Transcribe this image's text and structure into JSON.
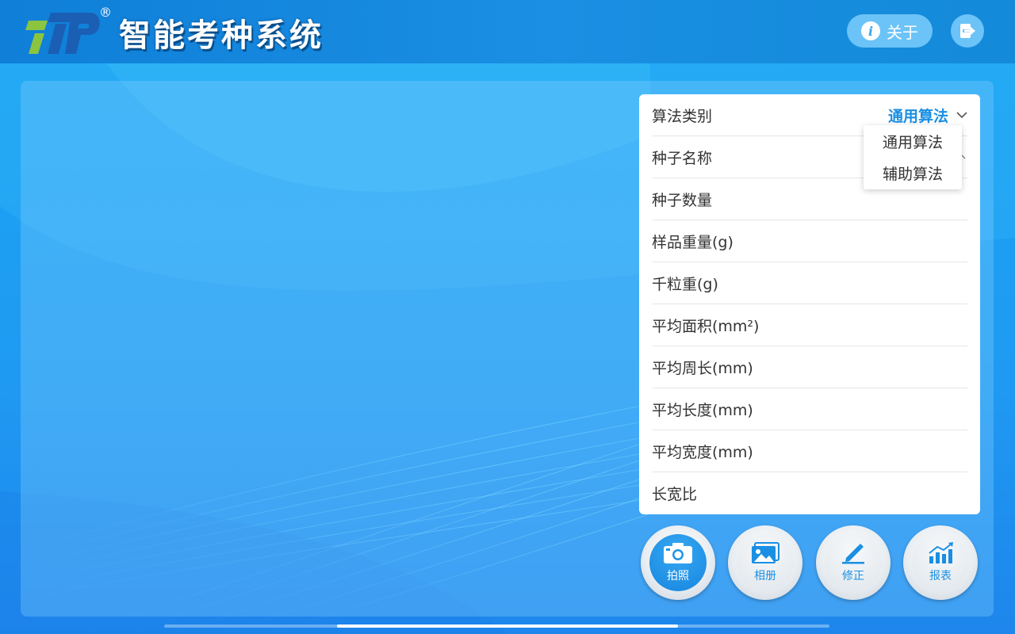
{
  "header": {
    "app_title": "智能考种系统",
    "registered_mark": "®",
    "about_label": "关于",
    "info_icon_glyph": "i"
  },
  "stats": {
    "algorithm": {
      "label": "算法类别",
      "value": "通用算法"
    },
    "rows": [
      {
        "label": "种子名称"
      },
      {
        "label": "种子数量"
      },
      {
        "label": "样品重量(g)"
      },
      {
        "label": "千粒重(g)"
      },
      {
        "label": "平均面积(mm²)"
      },
      {
        "label": "平均周长(mm)"
      },
      {
        "label": "平均长度(mm)"
      },
      {
        "label": "平均宽度(mm)"
      },
      {
        "label": "长宽比"
      }
    ]
  },
  "dropdown": {
    "options": [
      "通用算法",
      "辅助算法"
    ]
  },
  "actions": [
    {
      "label": "拍照",
      "icon": "camera-icon",
      "active": true
    },
    {
      "label": "相册",
      "icon": "gallery-icon",
      "active": false
    },
    {
      "label": "修正",
      "icon": "edit-icon",
      "active": false
    },
    {
      "label": "报表",
      "icon": "report-chart-icon",
      "active": false
    }
  ],
  "colors": {
    "accent": "#1a8fe3",
    "header_bg": "#1a8fe3",
    "button_pill": "#6cc3f7"
  }
}
